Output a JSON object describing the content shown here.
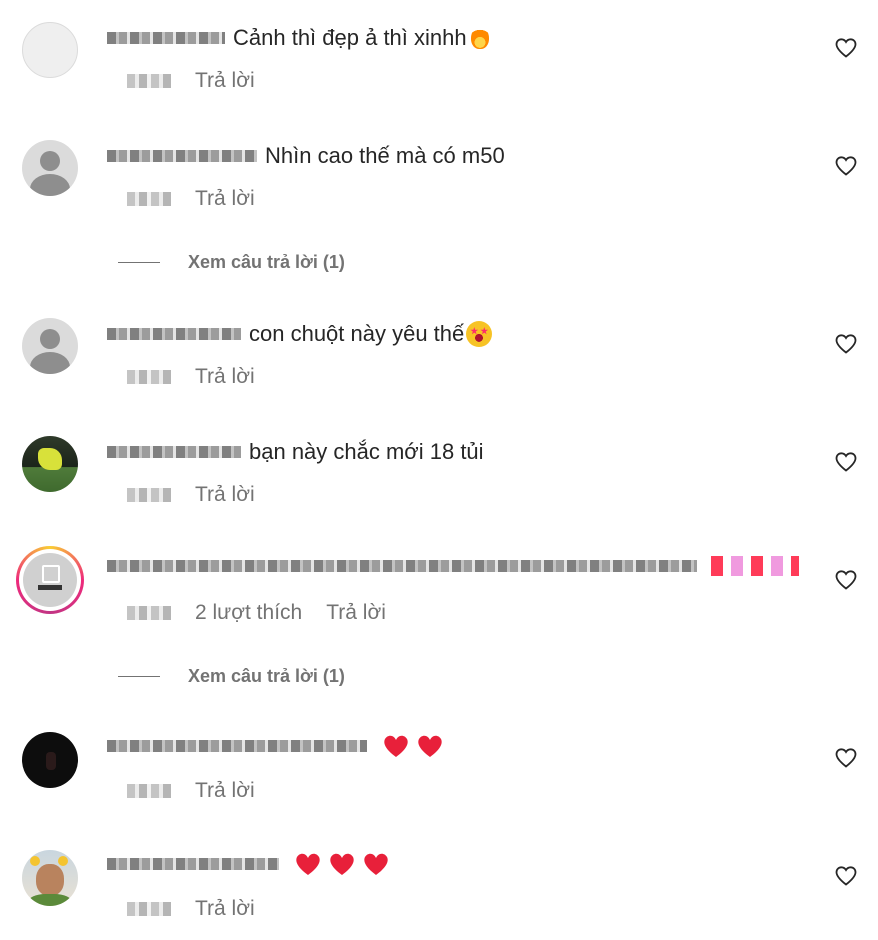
{
  "comments": [
    {
      "text": "Cảnh thì đẹp ả thì xinhh",
      "reply_label": "Trả lời",
      "avatar": "plain-gray-avatar"
    },
    {
      "text": "Nhìn cao thế mà có m50",
      "reply_label": "Trả lời",
      "avatar": "default-user-avatar",
      "view_replies": "Xem câu trả lời (1)"
    },
    {
      "text": "con chuột này yêu thế",
      "reply_label": "Trả lời",
      "avatar": "default-user-avatar"
    },
    {
      "text": "bạn này chắc mới 18 tủi",
      "reply_label": "Trả lời",
      "avatar": "sports-avatar"
    },
    {
      "text": "",
      "likes": "2 lượt thích",
      "reply_label": "Trả lời",
      "avatar": "story-ring-avatar",
      "view_replies": "Xem câu trả lời (1)"
    },
    {
      "text": "",
      "reply_label": "Trả lời",
      "avatar": "dark-avatar"
    },
    {
      "text": "",
      "reply_label": "Trả lời",
      "avatar": "person-avatar"
    }
  ],
  "icons": {
    "like": "heart-outline-icon",
    "fire": "fire-emoji",
    "star_eyes": "star-struck-emoji",
    "red_heart": "red-heart-emoji"
  },
  "colors": {
    "text": "#262626",
    "secondary": "#737373",
    "heart_red": "#e8203a"
  }
}
